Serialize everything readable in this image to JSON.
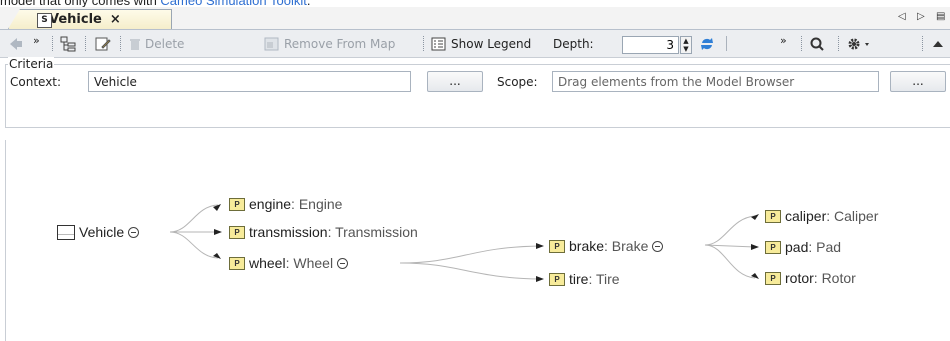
{
  "top_text": {
    "before": "model that only comes with",
    "link": "Cameo Simulation Toolkit",
    "after": "."
  },
  "tab": {
    "icon": "S",
    "title": "Vehicle",
    "close": "×"
  },
  "tab_nav": {
    "prev": "◁",
    "next": "▷",
    "menu": "▤"
  },
  "toolbar": {
    "more": "»",
    "delete": "Delete",
    "remove_from_map": "Remove From Map",
    "show_legend": "Show Legend",
    "depth_label": "Depth:",
    "depth_value": "3",
    "more2": "»"
  },
  "criteria": {
    "title": "Criteria",
    "context_label": "Context:",
    "context_value": "Vehicle",
    "context_browse": "...",
    "scope_label": "Scope:",
    "scope_placeholder": "Drag elements from the Model Browser",
    "scope_browse": "..."
  },
  "map": {
    "root": "Vehicle",
    "p_icon": "P",
    "engine": {
      "name": "engine",
      "type": " : Engine"
    },
    "transmission": {
      "name": "transmission",
      "type": " : Transmission"
    },
    "wheel": {
      "name": "wheel",
      "type": " : Wheel"
    },
    "brake": {
      "name": "brake",
      "type": " : Brake"
    },
    "tire": {
      "name": "tire",
      "type": " : Tire"
    },
    "caliper": {
      "name": "caliper",
      "type": " : Caliper"
    },
    "pad": {
      "name": "pad",
      "type": " : Pad"
    },
    "rotor": {
      "name": "rotor",
      "type": " : Rotor"
    }
  },
  "colors": {
    "link": "#2f6fd1",
    "tab_bg": "#fefbe9",
    "part_icon": "#f7eb9a",
    "refresh_icon": "#2f7fd6"
  }
}
